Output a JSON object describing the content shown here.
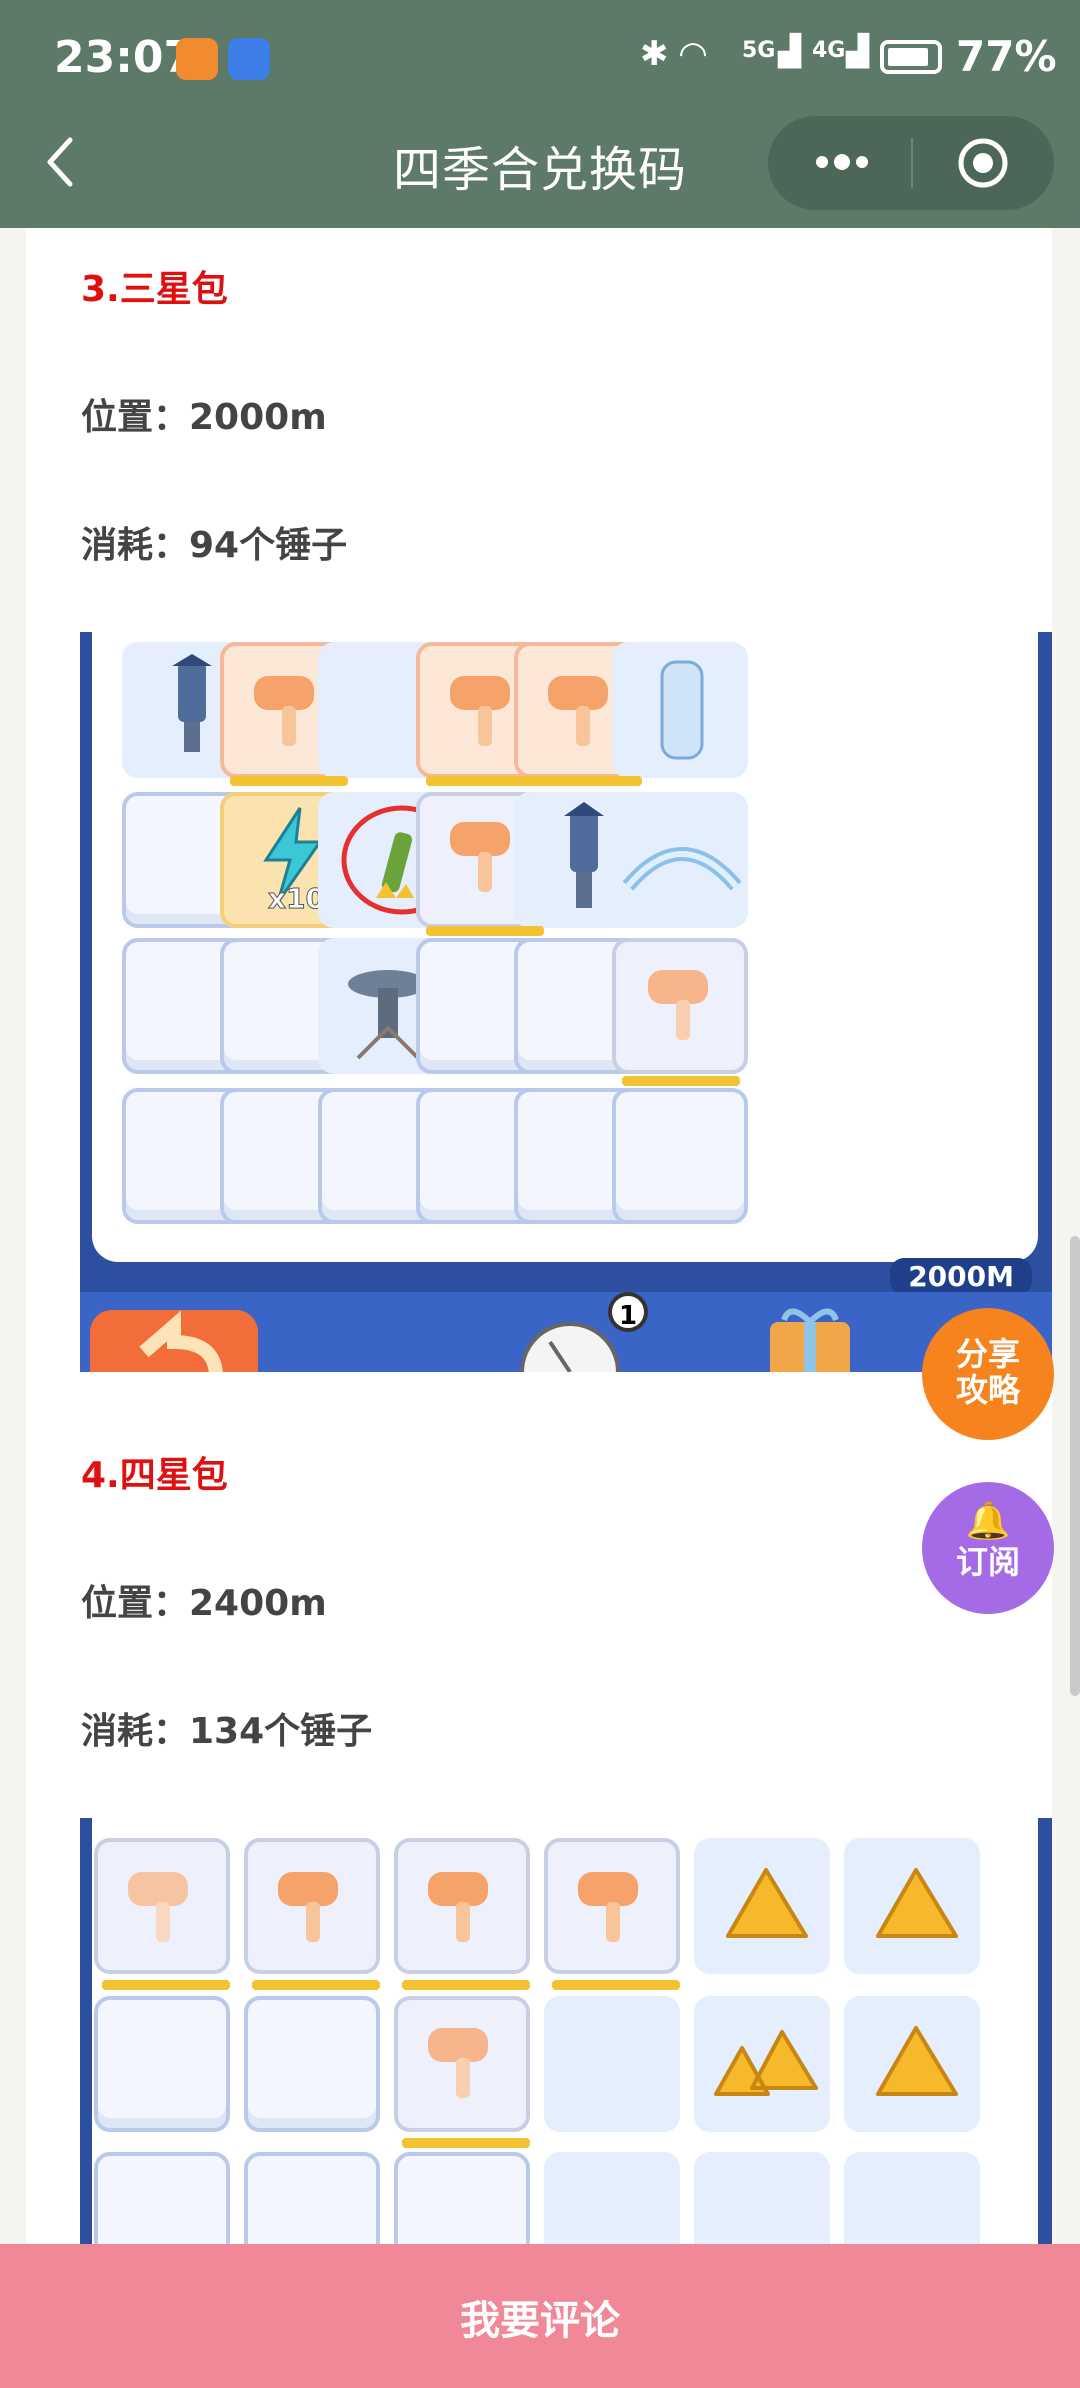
{
  "status": {
    "time": "23:07",
    "net1": "5G",
    "net2": "4G",
    "battery": "77%"
  },
  "nav": {
    "title": "四季合兑换码"
  },
  "sections": [
    {
      "heading": "3.三星包",
      "position": "位置：2000m",
      "cost": "消耗：94个锤子",
      "board_caption": "2000M",
      "badge_count": "1",
      "bolt_count": "x10"
    },
    {
      "heading": "4.四星包",
      "position": "位置：2400m",
      "cost": "消耗：134个锤子"
    }
  ],
  "fab": {
    "share_line1": "分享",
    "share_line2": "攻略",
    "subscribe": "订阅"
  },
  "footer": {
    "comment": "我要评论"
  },
  "colors": {
    "header": "#5d7a68",
    "heading_red": "#e01010",
    "footer": "#f08898",
    "share": "#f6831d",
    "subscribe": "#a56be6"
  }
}
